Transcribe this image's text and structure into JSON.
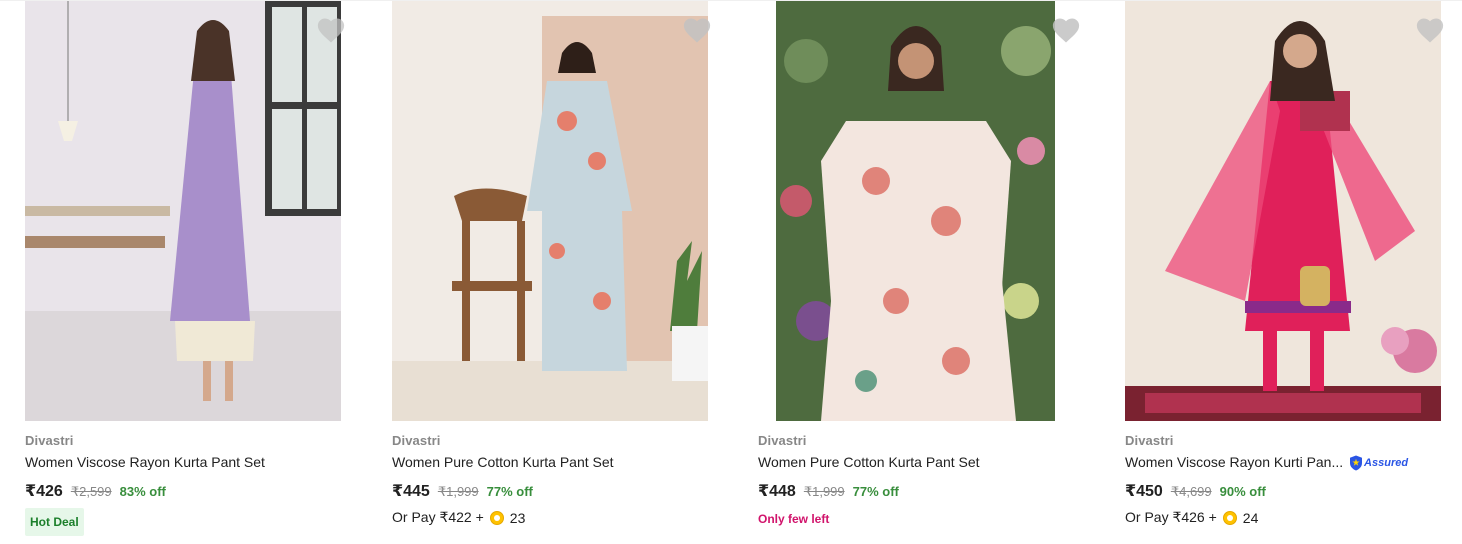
{
  "products": [
    {
      "brand": "Divastri",
      "title": "Women Viscose Rayon Kurta Pant Set",
      "price": "₹426",
      "mrp": "₹2,599",
      "discount": "83% off",
      "badge": "Hot Deal",
      "image_colors": {
        "bg": "#e9e4ea",
        "garment": "#a88fcb",
        "accent": "#f0e9d6"
      }
    },
    {
      "brand": "Divastri",
      "title": "Women Pure Cotton Kurta Pant Set",
      "price": "₹445",
      "mrp": "₹1,999",
      "discount": "77% off",
      "pay_prefix": "Or Pay ₹422 +",
      "coins": "23",
      "image_colors": {
        "bg": "#f1ebe5",
        "garment": "#c6d6dd",
        "accent": "#e57f6c"
      }
    },
    {
      "brand": "Divastri",
      "title": "Women Pure Cotton Kurta Pant Set",
      "price": "₹448",
      "mrp": "₹1,999",
      "discount": "77% off",
      "stock_note": "Only few left",
      "image_colors": {
        "bg": "#4e6b3f",
        "garment": "#f3e6df",
        "accent": "#e0847a"
      }
    },
    {
      "brand": "Divastri",
      "title": "Women Viscose Rayon Kurti Pan...",
      "assured_label": "Assured",
      "price": "₹450",
      "mrp": "₹4,699",
      "discount": "90% off",
      "pay_prefix": "Or Pay ₹426 +",
      "coins": "24",
      "image_colors": {
        "bg": "#efe6dc",
        "garment": "#e0205a",
        "accent": "#b0324f"
      }
    }
  ],
  "colors": {
    "discount_green": "#388e3c",
    "stock_pink": "#d1136b",
    "assured_blue": "#2a55e5",
    "wishlist_heart": "#c2c2c2"
  }
}
